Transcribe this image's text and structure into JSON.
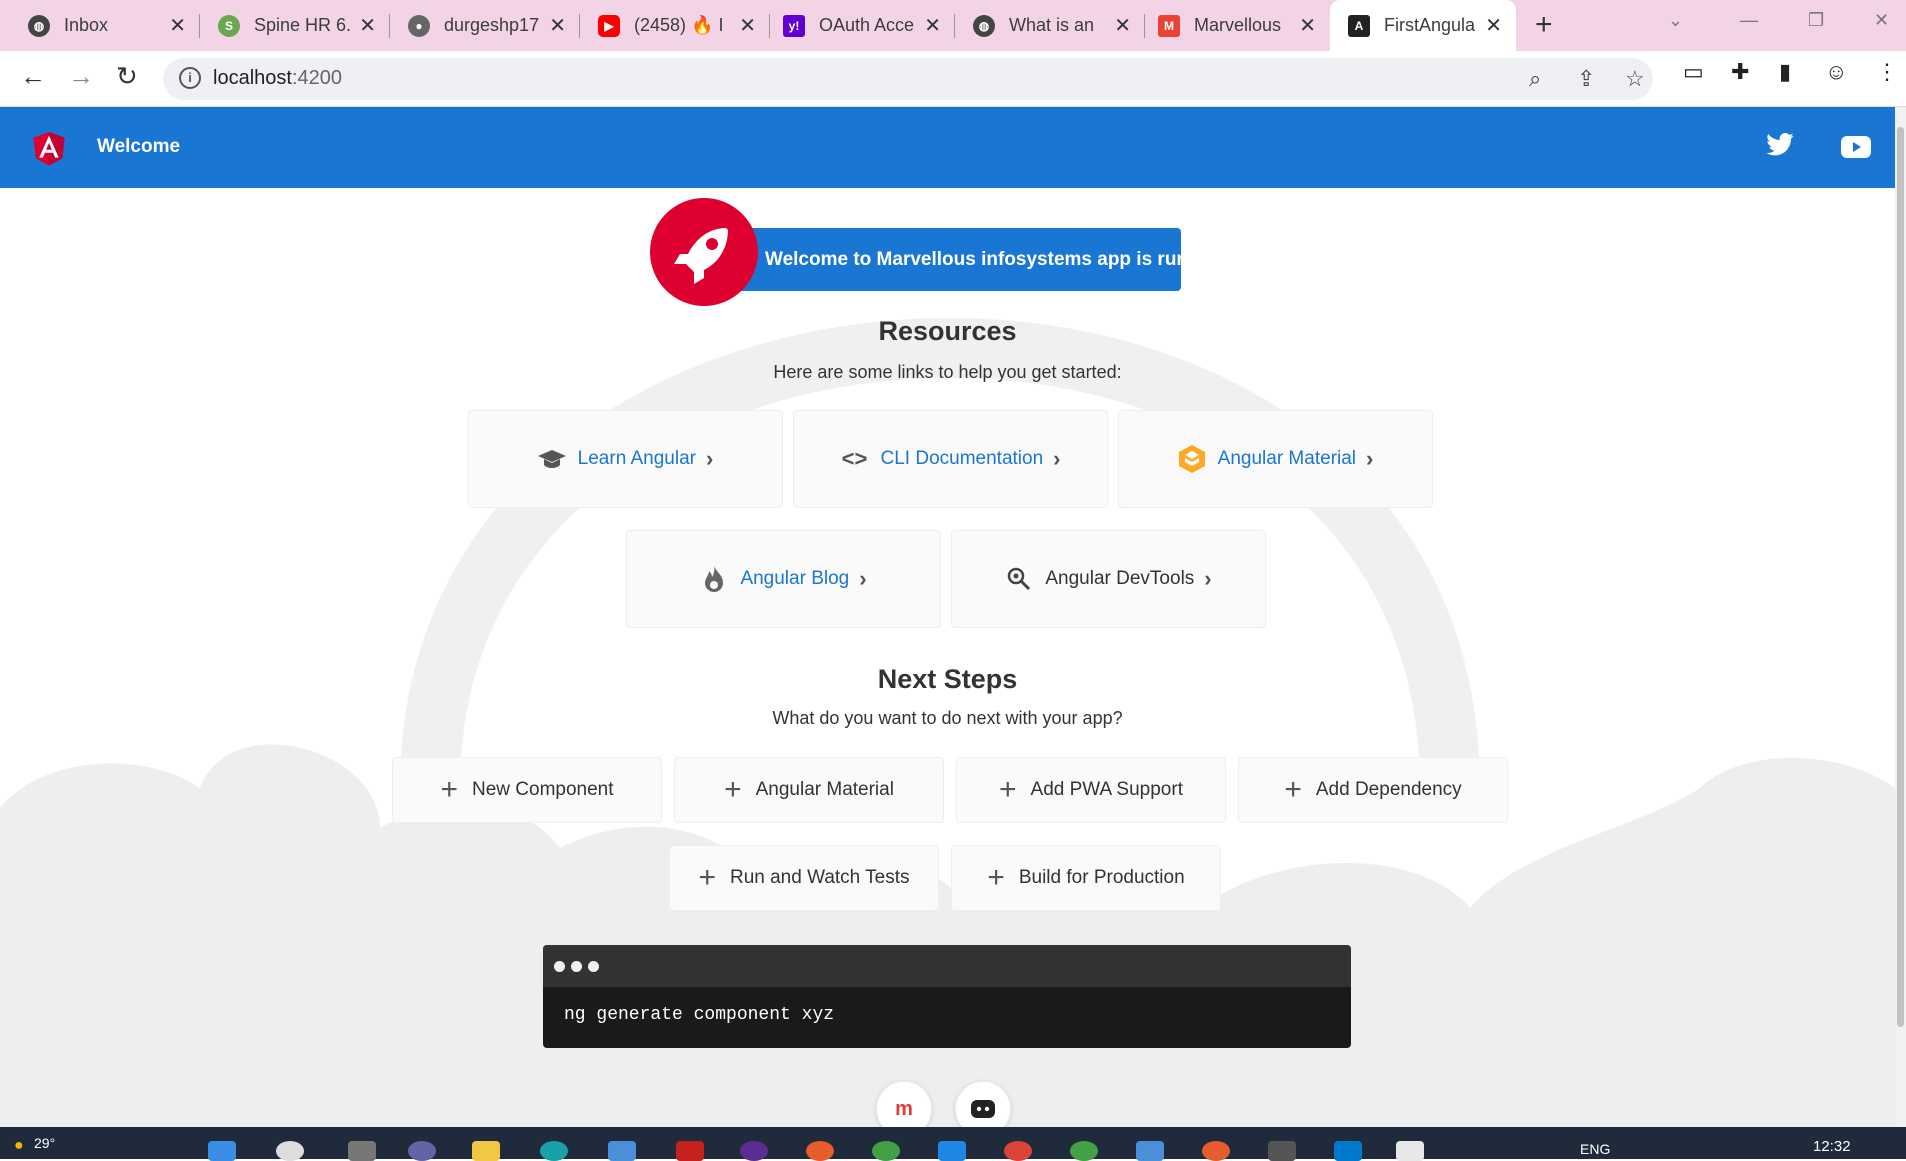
{
  "browser": {
    "tabs": [
      {
        "title": "Inbox",
        "color": "#444"
      },
      {
        "title": "Spine HR 6.",
        "color": "#6aa84f"
      },
      {
        "title": "durgeshp17",
        "color": "#666"
      },
      {
        "title": "(2458) 🔥 I",
        "color": "#ff0000"
      },
      {
        "title": "OAuth Acce",
        "color": "#6001d2"
      },
      {
        "title": "What is an",
        "color": "#444"
      },
      {
        "title": "Marvellous",
        "color": "#ea4335"
      },
      {
        "title": "FirstAngula",
        "color": "#222"
      }
    ],
    "url_host": "localhost",
    "url_port": ":4200"
  },
  "app": {
    "header_title": "Welcome",
    "banner": "Welcome to Marvellous infosystems app is running!",
    "resources_title": "Resources",
    "resources_sub": "Here are some links to help you get started:",
    "resources": [
      {
        "label": "Learn Angular",
        "icon": "graduation-cap-icon"
      },
      {
        "label": "CLI Documentation",
        "icon": "code-brackets-icon"
      },
      {
        "label": "Angular Material",
        "icon": "material-hexagon-icon"
      },
      {
        "label": "Angular Blog",
        "icon": "flame-icon"
      },
      {
        "label": "Angular DevTools",
        "icon": "search-gear-icon"
      }
    ],
    "next_title": "Next Steps",
    "next_sub": "What do you want to do next with your app?",
    "steps": [
      "New Component",
      "Angular Material",
      "Add PWA Support",
      "Add Dependency",
      "Run and Watch Tests",
      "Build for Production"
    ],
    "terminal_command": "ng generate component xyz"
  },
  "taskbar": {
    "temperature": "29°",
    "language": "ENG",
    "time": "12:32"
  }
}
